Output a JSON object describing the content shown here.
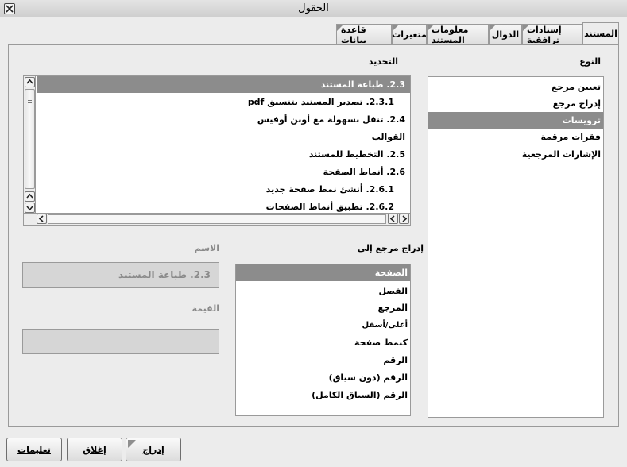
{
  "window": {
    "title": "الحقول"
  },
  "tabs": [
    {
      "label": "المستند"
    },
    {
      "label": "إسنادات ترافقية"
    },
    {
      "label": "الدوال"
    },
    {
      "label": "معلومات المستند"
    },
    {
      "label": "متغيرات"
    },
    {
      "label": "قاعدة بيانات"
    }
  ],
  "type_panel": {
    "label": "النوع",
    "items": [
      "تعيين مرجع",
      "إدراج مرجع",
      "ترويسات",
      "فقرات مرقمة",
      "الإشارات المرجعية"
    ],
    "selected_index": 2
  },
  "selection_panel": {
    "label": "التحديد",
    "items": [
      "2.3.  طباعة المستند",
      "2.3.1.  تصدير المستند بتنسيق pdf",
      "2.4.  تنقل بسهولة مع أوبن أوفيس",
      "القوالب",
      "2.5.  التخطيط للمستند",
      "2.6.  أنماط الصفحة",
      "2.6.1.  أنشئ نمط صفحة جديد",
      "2.6.2.  تطبيق أنماط الصفحات"
    ],
    "selected_index": 0
  },
  "insert_ref_panel": {
    "label": "إدراج مرجع إلى",
    "items": [
      "الصفحة",
      "الفصل",
      "المرجع",
      "أعلى/أسفل",
      "كنمط صفحة",
      "الرقم",
      "الرقم (دون سياق)",
      "الرقم (السياق الكامل)"
    ],
    "selected_index": 0
  },
  "name_field": {
    "label": "الاسم",
    "value": "2.3.  طباعة المستند"
  },
  "value_field": {
    "label": "القيمة",
    "value": ""
  },
  "buttons": {
    "insert": "إدراج",
    "close": "إغلاق",
    "help": "تعليمات"
  }
}
